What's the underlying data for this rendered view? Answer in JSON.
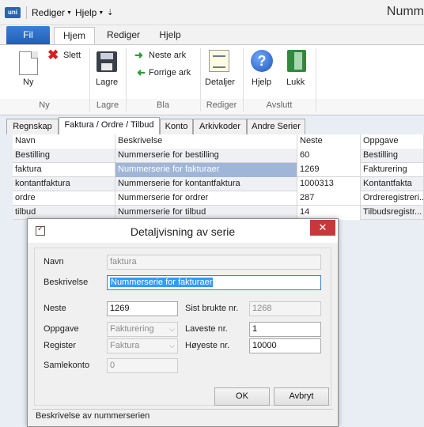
{
  "window": {
    "title": "Numm",
    "qat": {
      "rediger": "Rediger",
      "hjelp": "Hjelp",
      "more": "⇣"
    },
    "logo": "uni"
  },
  "ribbon": {
    "file_tab": "Fil",
    "tabs": [
      "Hjem",
      "Rediger",
      "Hjelp"
    ],
    "groups": {
      "ny": {
        "label": "Ny",
        "ny_btn": "Ny",
        "slett_btn": "Slett"
      },
      "lagre": {
        "label": "Lagre",
        "lagre_btn": "Lagre"
      },
      "bla": {
        "label": "Bla",
        "neste_btn": "Neste ark",
        "forrige_btn": "Forrige ark"
      },
      "rediger": {
        "label": "Rediger",
        "detaljer_btn": "Detaljer"
      },
      "avslutt": {
        "label": "Avslutt",
        "hjelp_btn": "Hjelp",
        "lukk_btn": "Lukk"
      }
    }
  },
  "content_tabs": [
    "Regnskap",
    "Faktura / Ordre / Tilbud",
    "Konto",
    "Arkivkoder",
    "Andre Serier"
  ],
  "grid": {
    "headers": [
      "Navn",
      "Beskrivelse",
      "Neste",
      "Oppgave"
    ],
    "rows": [
      [
        "Bestilling",
        "Nummerserie for bestilling",
        "60",
        "Bestilling"
      ],
      [
        "faktura",
        "Nummerserie for fakturaer",
        "1269",
        "Fakturering"
      ],
      [
        "kontantfaktura",
        "Nummerserie for kontantfaktura",
        "1000313",
        "Kontantfakta"
      ],
      [
        "ordre",
        "Nummerserie for ordrer",
        "287",
        "Ordreregistreri..."
      ],
      [
        "tilbud",
        "Nummerserie for tilbud",
        "14",
        "Tilbudsregistr..."
      ]
    ]
  },
  "dialog": {
    "title": "Detaljvisning av serie",
    "close": "✕",
    "navn_label": "Navn",
    "navn_value": "faktura",
    "beskrivelse_label": "Beskrivelse",
    "beskrivelse_value": "Nummerserie for fakturaer",
    "neste_label": "Neste",
    "neste_value": "1269",
    "sist_label": "Sist brukte nr.",
    "sist_value": "1268",
    "oppgave_label": "Oppgave",
    "oppgave_value": "Fakturering",
    "laveste_label": "Laveste nr.",
    "laveste_value": "1",
    "register_label": "Register",
    "register_value": "Faktura",
    "hoyeste_label": "Høyeste nr.",
    "hoyeste_value": "10000",
    "samlekonto_label": "Samlekonto",
    "samlekonto_value": "0",
    "ok_button": "OK",
    "cancel_button": "Avbryt",
    "status": "Beskrivelse av nummerserien"
  }
}
